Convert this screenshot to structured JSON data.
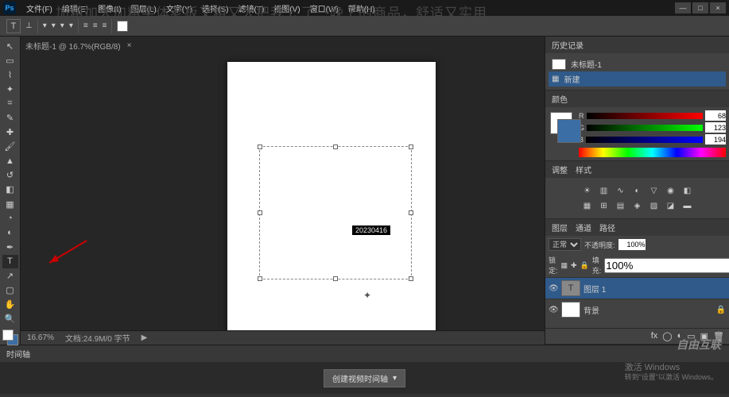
{
  "overlay": "加粗加大加粗字体老板又粗又大把我 c 了一晚上的商品，舒适又实用",
  "app": {
    "logo": "Ps"
  },
  "menu": {
    "file": "文件(F)",
    "edit": "编辑(E)",
    "image": "图像(I)",
    "layer": "图层(L)",
    "type": "文字(Y)",
    "select": "选择(S)",
    "filter": "滤镜(T)",
    "view": "视图(V)",
    "window": "窗口(W)",
    "help": "帮助(H)"
  },
  "win": {
    "min": "—",
    "max": "□",
    "close": "×"
  },
  "option": {
    "tool": "T",
    "orient": "⊥",
    "font": "▾",
    "style": "▾",
    "size": "▾",
    "aa": "▾",
    "align_l": "≡",
    "align_c": "≡",
    "align_r": "≡"
  },
  "tab": {
    "name": "未标题-1 @ 16.7%(RGB/8)",
    "close": "×"
  },
  "tooltip": "20230416",
  "status": {
    "zoom": "16.67%",
    "doc": "文档:24.9M/0 字节",
    "tip": "▶"
  },
  "history": {
    "tab": "历史记录",
    "doc": "未标题-1",
    "step": "新建"
  },
  "color": {
    "tab": "颜色",
    "r": "R",
    "g": "G",
    "b": "B",
    "rv": "68",
    "gv": "123",
    "bv": "194"
  },
  "adjust": {
    "tab1": "调整",
    "tab2": "样式"
  },
  "layers": {
    "tab": "图层",
    "ch": "通道",
    "path": "路径",
    "mode": "正常",
    "opacity_l": "不透明度:",
    "opacity": "100%",
    "lock": "锁定:",
    "fill_l": "填充:",
    "fill": "100%",
    "l1": "图层 1",
    "bg": "背景",
    "lockicon": "🔒"
  },
  "timeline": {
    "tab": "时间轴",
    "btn": "创建视频时间轴",
    "arrow": "▾"
  },
  "activate": {
    "l1": "激活 Windows",
    "l2": "转到\"设置\"以激活 Windows。"
  },
  "watermark": "自由互联"
}
